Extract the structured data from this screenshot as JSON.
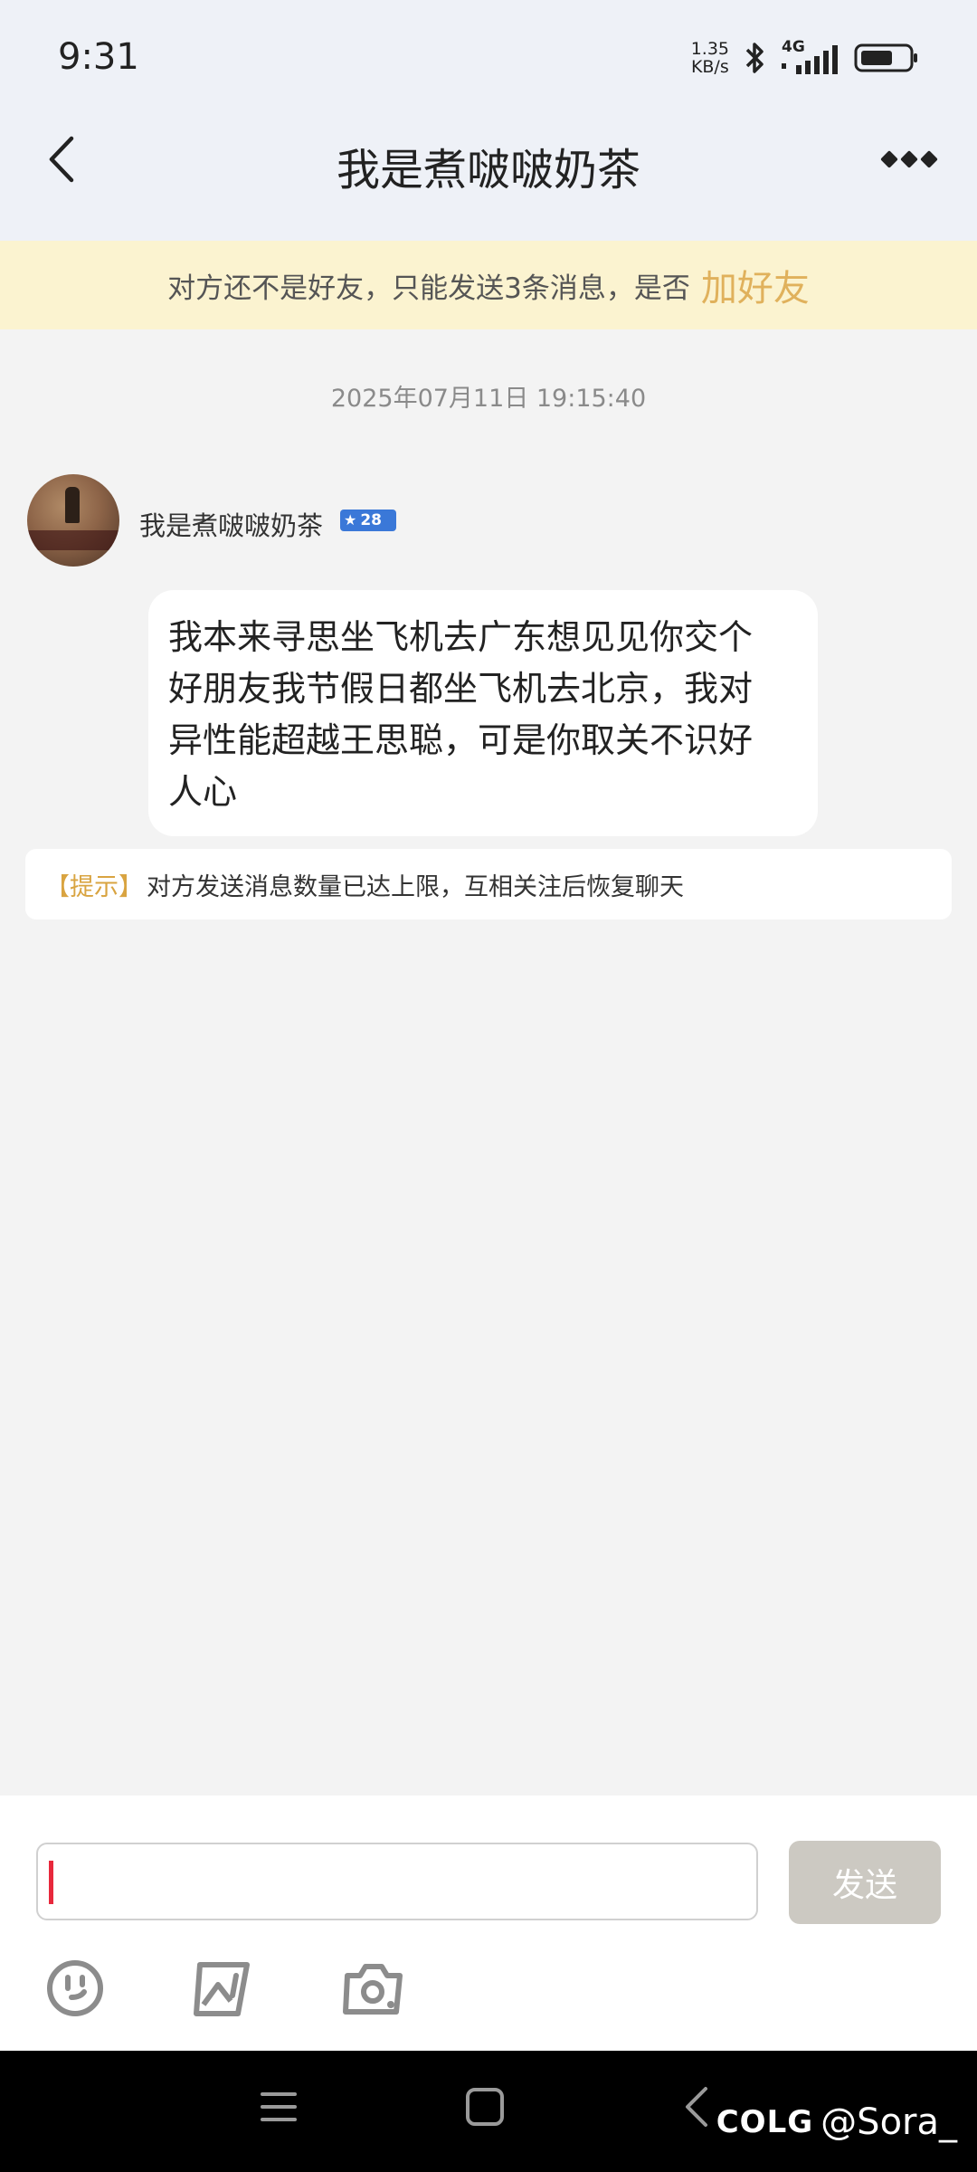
{
  "status_bar": {
    "time": "9:31",
    "net_speed_value": "1.35",
    "net_speed_unit": "KB/s",
    "network_type": "4G",
    "icons": [
      "bluetooth-icon",
      "signal-icon",
      "battery-icon"
    ]
  },
  "header": {
    "title": "我是煮啵啵奶茶",
    "back_icon": "chevron-left-icon",
    "more_icon": "more-dots-icon"
  },
  "notice": {
    "text": "对方还不是好友，只能发送3条消息，是否",
    "link": "加好友"
  },
  "timestamp": "2025年07月11日 19:15:40",
  "message": {
    "sender_name": "我是煮啵啵奶茶",
    "level": "28",
    "lines": [
      "我本来寻思坐飞机去广东想见见你交个",
      "好朋友我节假日都坐飞机去北京，我对",
      "异性能超越王思聪，可是你取关不识好",
      "人心"
    ]
  },
  "hint": {
    "tag": "【提示】",
    "text": "对方发送消息数量已达上限，互相关注后恢复聊天"
  },
  "composer": {
    "input_value": "",
    "send_label": "发送",
    "tools": [
      "emoji-icon",
      "image-icon",
      "camera-icon"
    ]
  },
  "watermark": {
    "logo": "COLG",
    "handle": "@Sora_"
  },
  "colors": {
    "accent": "#e0b15c",
    "banner_bg": "#fbf3d0",
    "header_bg": "#eef1f7",
    "cursor": "#e8283c",
    "send_disabled": "#ccc9c2"
  }
}
